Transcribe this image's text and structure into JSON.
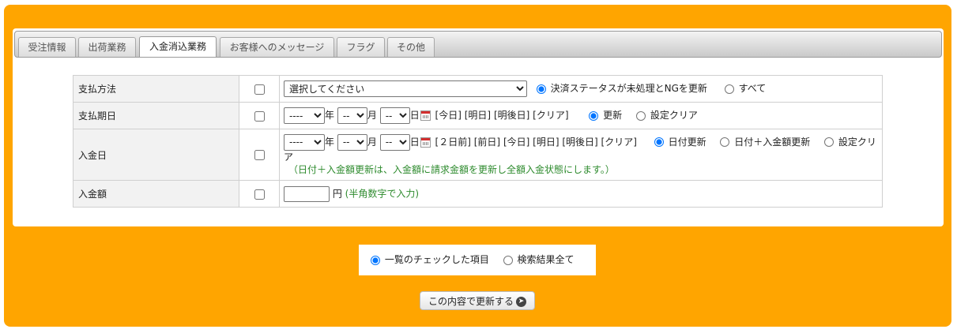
{
  "tabs": [
    {
      "label": "受注情報",
      "active": false
    },
    {
      "label": "出荷業務",
      "active": false
    },
    {
      "label": "入金消込業務",
      "active": true
    },
    {
      "label": "お客様へのメッセージ",
      "active": false
    },
    {
      "label": "フラグ",
      "active": false
    },
    {
      "label": "その他",
      "active": false
    }
  ],
  "rows": {
    "payment_method": {
      "label": "支払方法",
      "select_value": "選択してください",
      "radio_update": "決済ステータスが未処理とNGを更新",
      "radio_all": "すべて"
    },
    "payment_due": {
      "label": "支払期日",
      "year_value": "----",
      "month_value": "--",
      "day_value": "--",
      "unit_year": "年",
      "unit_month": "月",
      "unit_day": "日",
      "link_today": "[今日]",
      "link_tomorrow": "[明日]",
      "link_day_after": "[明後日]",
      "link_clear": "[クリア]",
      "radio_update": "更新",
      "radio_clear": "設定クリア"
    },
    "payment_date": {
      "label": "入金日",
      "year_value": "----",
      "month_value": "--",
      "day_value": "--",
      "unit_year": "年",
      "unit_month": "月",
      "unit_day": "日",
      "link_2days_ago": "[２日前]",
      "link_yesterday": "[前日]",
      "link_today": "[今日]",
      "link_tomorrow": "[明日]",
      "link_day_after": "[明後日]",
      "link_clear": "[クリア]",
      "radio_date_update": "日付更新",
      "radio_date_amount_update": "日付＋入金額更新",
      "radio_clear": "設定クリア",
      "note": "（日付＋入金額更新は、入金額に請求金額を更新し全額入金状態にします。）"
    },
    "payment_amount": {
      "label": "入金額",
      "unit": "円",
      "note": "(半角数字で入力)"
    }
  },
  "scope": {
    "checked_items": "一覧のチェックした項目",
    "all_results": "検索結果全て"
  },
  "submit": {
    "label": "この内容で更新する",
    "icon": "arrow-right-circle-icon"
  },
  "colors": {
    "frame": "#ffa500",
    "note": "#2e8b2e",
    "calendar": "#d32f2f"
  }
}
